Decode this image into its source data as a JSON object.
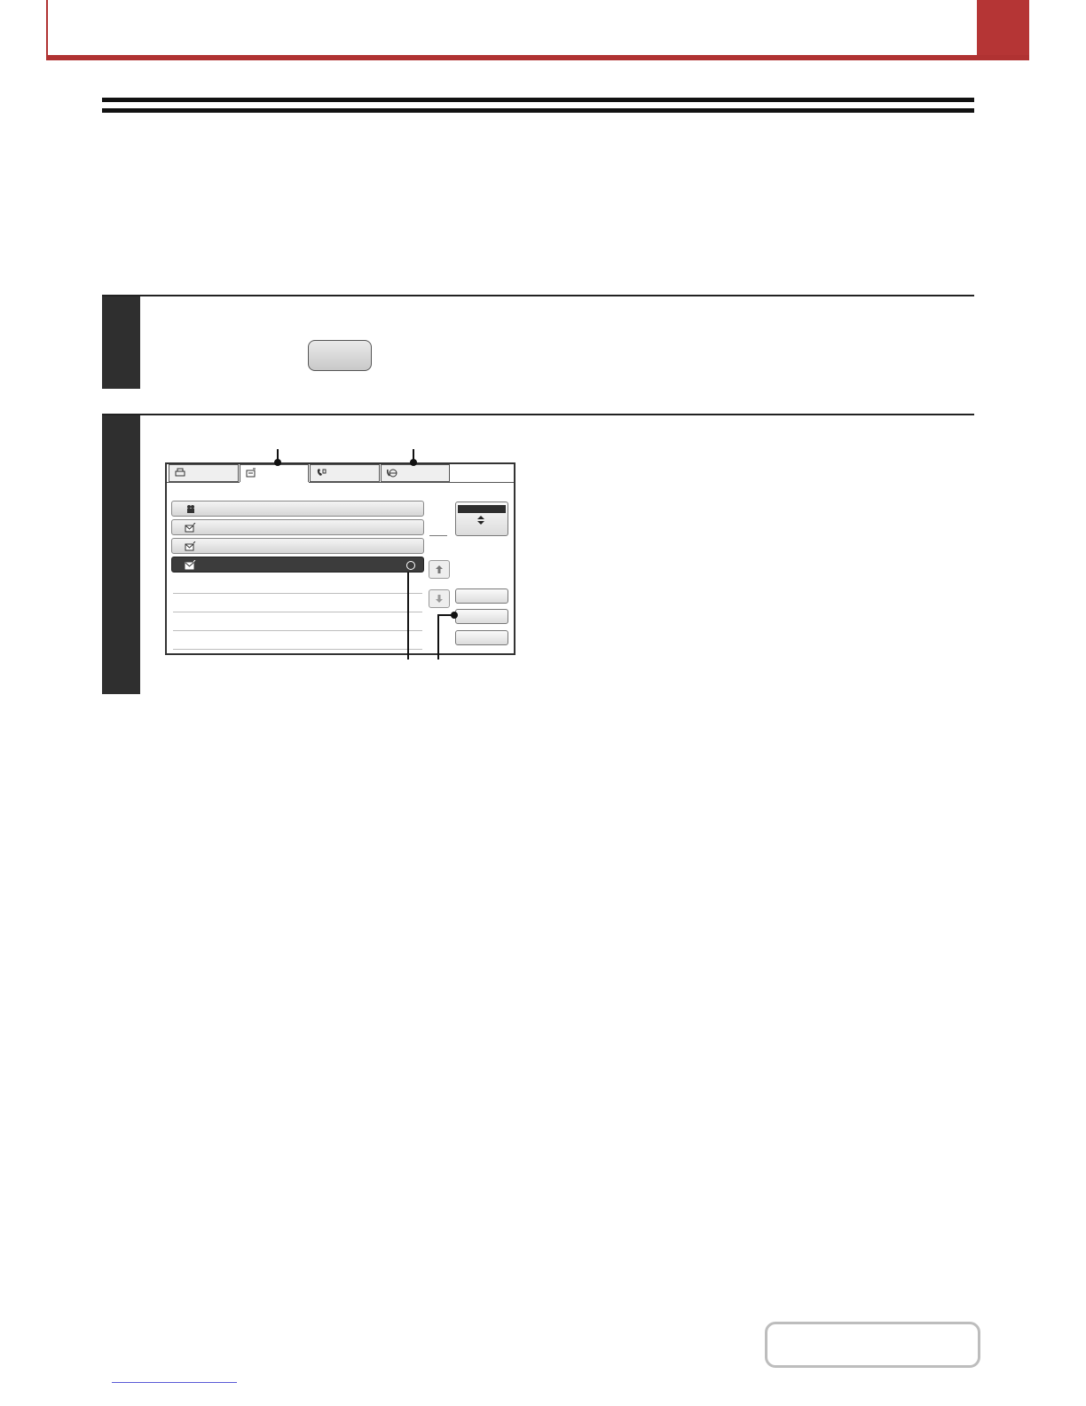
{
  "header": {
    "accent_color": "#b53535"
  },
  "steps": [
    {
      "id": 1,
      "key_button_label": ""
    },
    {
      "id": 2
    }
  ],
  "screen": {
    "tabs": [
      {
        "label": "",
        "icon": "printer-icon"
      },
      {
        "label": "",
        "icon": "scanner-icon"
      },
      {
        "label": "",
        "icon": "fax-icon"
      },
      {
        "label": "",
        "icon": "internet-fax-icon"
      }
    ],
    "rows": [
      {
        "label": "",
        "icon": "group-icon",
        "selected": false
      },
      {
        "label": "",
        "icon": "email-icon",
        "selected": false
      },
      {
        "label": "",
        "icon": "email-icon",
        "selected": false
      },
      {
        "label": "",
        "icon": "email-icon",
        "selected": true
      }
    ],
    "side_buttons": [
      "",
      "",
      ""
    ]
  },
  "footer": {
    "contents_label": ""
  }
}
